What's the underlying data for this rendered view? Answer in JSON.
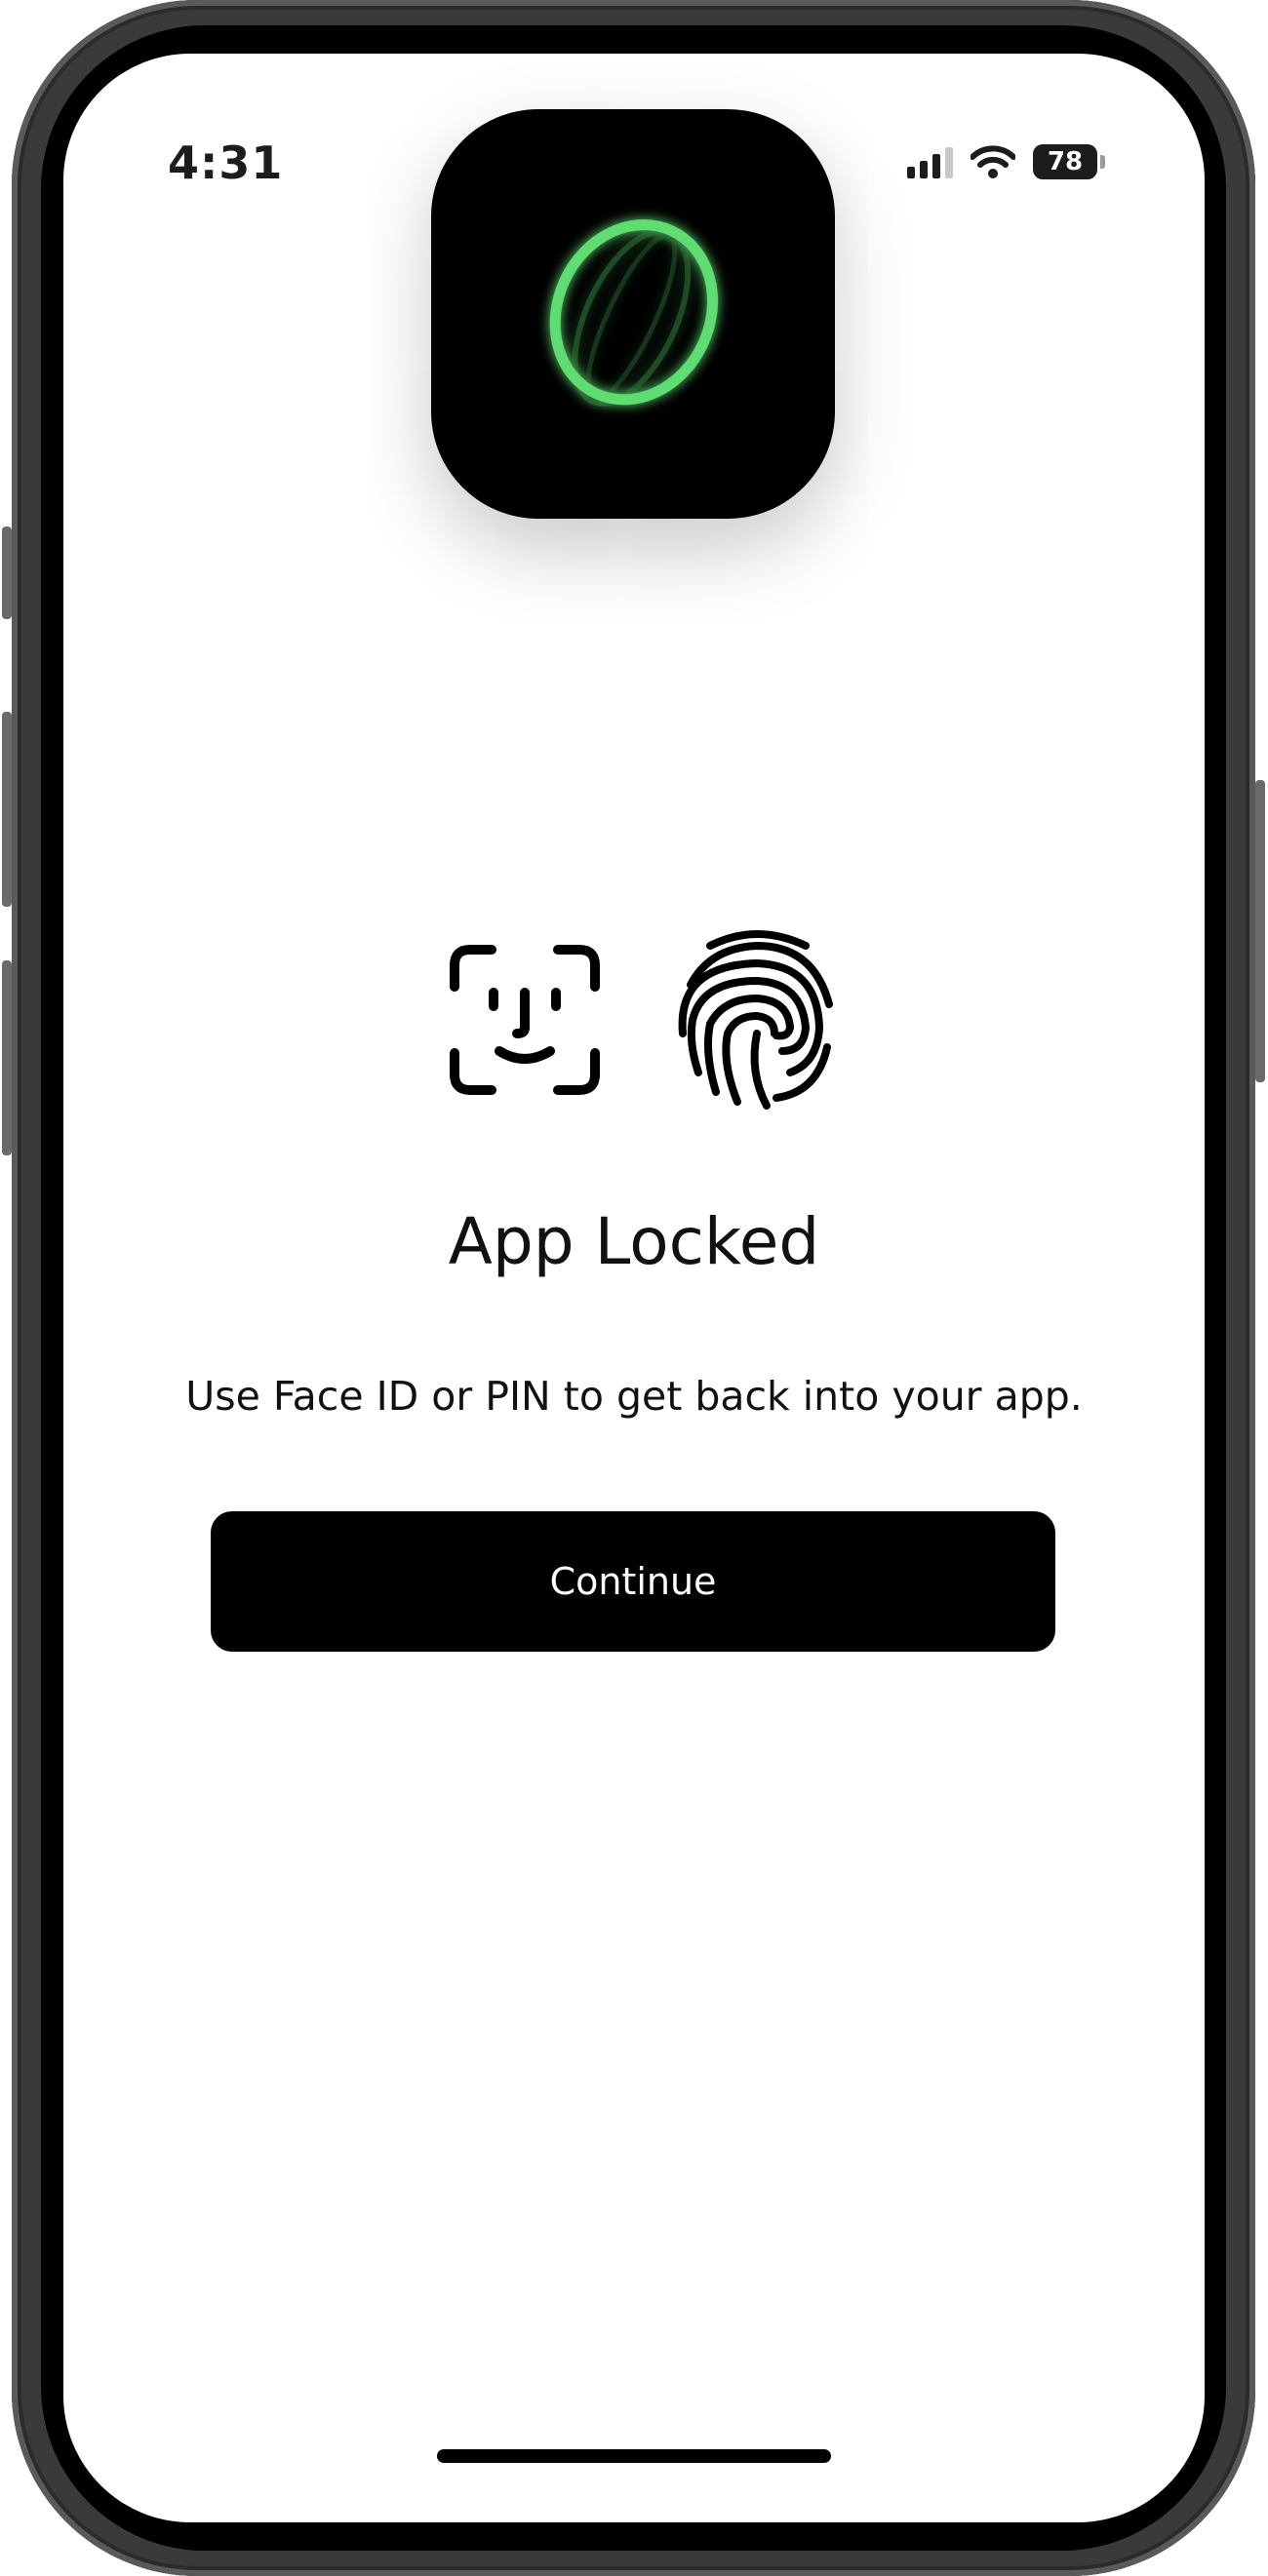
{
  "status_bar": {
    "time": "4:31",
    "battery_level": "78",
    "signal_icon": "cellular-signal-icon",
    "wifi_icon": "wifi-icon"
  },
  "app_icon": {
    "icon": "green-ring-logo-icon",
    "accent_color": "#5fdc72"
  },
  "auth_methods": {
    "face_icon": "face-id-icon",
    "fingerprint_icon": "fingerprint-icon"
  },
  "lock_screen": {
    "title": "App Locked",
    "message": "Use Face ID or PIN to get back into your app.",
    "continue_label": "Continue"
  }
}
